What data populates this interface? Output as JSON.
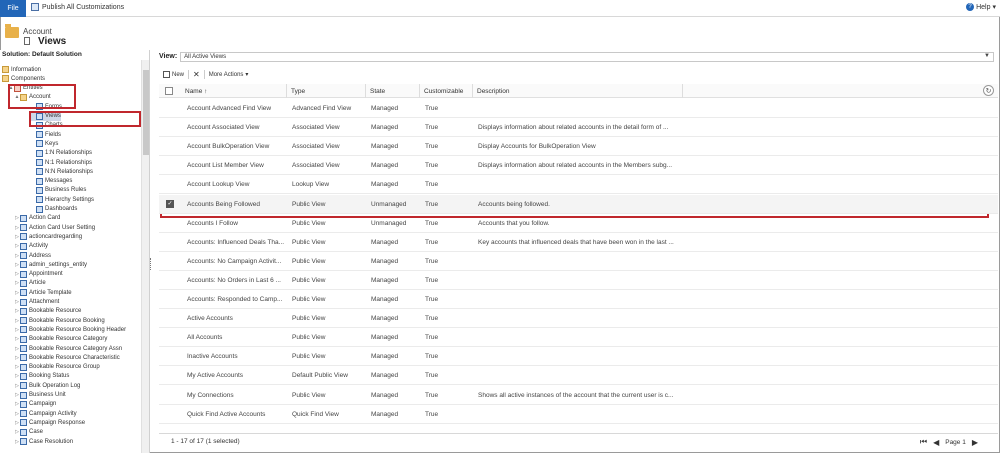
{
  "ribbon": {
    "file_label": "File",
    "publish_label": "Publish All Customizations",
    "help_label": "Help"
  },
  "header": {
    "entity_label": "Account",
    "page_title": "Views"
  },
  "nav": {
    "heading": "Solution: Default Solution",
    "items": [
      {
        "label": "Information",
        "level": 0,
        "twisty": "",
        "icon": "info-icon"
      },
      {
        "label": "Components",
        "level": 0,
        "twisty": "",
        "icon": "components-icon"
      },
      {
        "label": "Entities",
        "level": 1,
        "twisty": "▲",
        "icon": "entities-icon"
      },
      {
        "label": "Account",
        "level": 2,
        "twisty": "▲",
        "icon": "account-icon"
      },
      {
        "label": "Forms",
        "level": 3,
        "twisty": "",
        "icon": "forms-icon"
      },
      {
        "label": "Views",
        "level": 3,
        "twisty": "",
        "icon": "views-icon"
      },
      {
        "label": "Charts",
        "level": 3,
        "twisty": "",
        "icon": "charts-icon"
      },
      {
        "label": "Fields",
        "level": 3,
        "twisty": "",
        "icon": "fields-icon"
      },
      {
        "label": "Keys",
        "level": 3,
        "twisty": "",
        "icon": "keys-icon"
      },
      {
        "label": "1:N Relationships",
        "level": 3,
        "twisty": "",
        "icon": "relationship-icon"
      },
      {
        "label": "N:1 Relationships",
        "level": 3,
        "twisty": "",
        "icon": "relationship-icon"
      },
      {
        "label": "N:N Relationships",
        "level": 3,
        "twisty": "",
        "icon": "relationship-icon"
      },
      {
        "label": "Messages",
        "level": 3,
        "twisty": "",
        "icon": "messages-icon"
      },
      {
        "label": "Business Rules",
        "level": 3,
        "twisty": "",
        "icon": "rules-icon"
      },
      {
        "label": "Hierarchy Settings",
        "level": 3,
        "twisty": "",
        "icon": "hierarchy-icon"
      },
      {
        "label": "Dashboards",
        "level": 3,
        "twisty": "",
        "icon": "dashboards-icon"
      },
      {
        "label": "Action Card",
        "level": 2,
        "twisty": "▷",
        "icon": "entity-icon"
      },
      {
        "label": "Action Card User Setting",
        "level": 2,
        "twisty": "▷",
        "icon": "entity-icon"
      },
      {
        "label": "actioncardregarding",
        "level": 2,
        "twisty": "▷",
        "icon": "entity-icon"
      },
      {
        "label": "Activity",
        "level": 2,
        "twisty": "▷",
        "icon": "entity-icon"
      },
      {
        "label": "Address",
        "level": 2,
        "twisty": "▷",
        "icon": "entity-icon"
      },
      {
        "label": "admin_settings_entity",
        "level": 2,
        "twisty": "▷",
        "icon": "entity-icon"
      },
      {
        "label": "Appointment",
        "level": 2,
        "twisty": "▷",
        "icon": "entity-icon"
      },
      {
        "label": "Article",
        "level": 2,
        "twisty": "▷",
        "icon": "entity-icon"
      },
      {
        "label": "Article Template",
        "level": 2,
        "twisty": "▷",
        "icon": "entity-icon"
      },
      {
        "label": "Attachment",
        "level": 2,
        "twisty": "▷",
        "icon": "entity-icon"
      },
      {
        "label": "Bookable Resource",
        "level": 2,
        "twisty": "▷",
        "icon": "entity-icon"
      },
      {
        "label": "Bookable Resource Booking",
        "level": 2,
        "twisty": "▷",
        "icon": "entity-icon"
      },
      {
        "label": "Bookable Resource Booking Header",
        "level": 2,
        "twisty": "▷",
        "icon": "entity-icon"
      },
      {
        "label": "Bookable Resource Category",
        "level": 2,
        "twisty": "▷",
        "icon": "entity-icon"
      },
      {
        "label": "Bookable Resource Category Assn",
        "level": 2,
        "twisty": "▷",
        "icon": "entity-icon"
      },
      {
        "label": "Bookable Resource Characteristic",
        "level": 2,
        "twisty": "▷",
        "icon": "entity-icon"
      },
      {
        "label": "Bookable Resource Group",
        "level": 2,
        "twisty": "▷",
        "icon": "entity-icon"
      },
      {
        "label": "Booking Status",
        "level": 2,
        "twisty": "▷",
        "icon": "entity-icon"
      },
      {
        "label": "Bulk Operation Log",
        "level": 2,
        "twisty": "▷",
        "icon": "entity-icon"
      },
      {
        "label": "Business Unit",
        "level": 2,
        "twisty": "▷",
        "icon": "entity-icon"
      },
      {
        "label": "Campaign",
        "level": 2,
        "twisty": "▷",
        "icon": "entity-icon"
      },
      {
        "label": "Campaign Activity",
        "level": 2,
        "twisty": "▷",
        "icon": "entity-icon"
      },
      {
        "label": "Campaign Response",
        "level": 2,
        "twisty": "▷",
        "icon": "entity-icon"
      },
      {
        "label": "Case",
        "level": 2,
        "twisty": "▷",
        "icon": "entity-icon"
      },
      {
        "label": "Case Resolution",
        "level": 2,
        "twisty": "▷",
        "icon": "entity-icon"
      }
    ]
  },
  "view": {
    "label": "View:",
    "selected": "All Active Views"
  },
  "toolbar": {
    "new_label": "New",
    "more_actions_label": "More Actions"
  },
  "grid": {
    "columns": [
      "Name ↑",
      "Type",
      "State",
      "Customizable",
      "Description"
    ],
    "rows": [
      {
        "name": "Account Advanced Find View",
        "type": "Advanced Find View",
        "state": "Managed",
        "customizable": "True",
        "description": "",
        "selected": false
      },
      {
        "name": "Account Associated View",
        "type": "Associated View",
        "state": "Managed",
        "customizable": "True",
        "description": "Displays information about related accounts in the detail form of ...",
        "selected": false
      },
      {
        "name": "Account BulkOperation View",
        "type": "Associated View",
        "state": "Managed",
        "customizable": "True",
        "description": "Display Accounts for BulkOperation View",
        "selected": false
      },
      {
        "name": "Account List Member View",
        "type": "Associated View",
        "state": "Managed",
        "customizable": "True",
        "description": "Displays information about related accounts in the Members subg...",
        "selected": false
      },
      {
        "name": "Account Lookup View",
        "type": "Lookup View",
        "state": "Managed",
        "customizable": "True",
        "description": "",
        "selected": false
      },
      {
        "name": "Accounts Being Followed",
        "type": "Public View",
        "state": "Unmanaged",
        "customizable": "True",
        "description": "Accounts being followed.",
        "selected": true
      },
      {
        "name": "Accounts I Follow",
        "type": "Public View",
        "state": "Unmanaged",
        "customizable": "True",
        "description": "Accounts that you follow.",
        "selected": false
      },
      {
        "name": "Accounts: Influenced Deals Tha...",
        "type": "Public View",
        "state": "Managed",
        "customizable": "True",
        "description": "Key accounts that influenced deals that have been won in the last ...",
        "selected": false
      },
      {
        "name": "Accounts: No Campaign Activit...",
        "type": "Public View",
        "state": "Managed",
        "customizable": "True",
        "description": "",
        "selected": false
      },
      {
        "name": "Accounts: No Orders in Last 6 ...",
        "type": "Public View",
        "state": "Managed",
        "customizable": "True",
        "description": "",
        "selected": false
      },
      {
        "name": "Accounts: Responded to Camp...",
        "type": "Public View",
        "state": "Managed",
        "customizable": "True",
        "description": "",
        "selected": false
      },
      {
        "name": "Active Accounts",
        "type": "Public View",
        "state": "Managed",
        "customizable": "True",
        "description": "",
        "selected": false
      },
      {
        "name": "All Accounts",
        "type": "Public View",
        "state": "Managed",
        "customizable": "True",
        "description": "",
        "selected": false
      },
      {
        "name": "Inactive Accounts",
        "type": "Public View",
        "state": "Managed",
        "customizable": "True",
        "description": "",
        "selected": false
      },
      {
        "name": "My Active Accounts",
        "type": "Default Public View",
        "state": "Managed",
        "customizable": "True",
        "description": "",
        "selected": false
      },
      {
        "name": "My Connections",
        "type": "Public View",
        "state": "Managed",
        "customizable": "True",
        "description": "Shows all active instances of the account that the current user is c...",
        "selected": false
      },
      {
        "name": "Quick Find Active Accounts",
        "type": "Quick Find View",
        "state": "Managed",
        "customizable": "True",
        "description": "",
        "selected": false
      }
    ]
  },
  "footer": {
    "count_text": "1 - 17 of 17 (1 selected)",
    "page_label": "Page 1"
  },
  "colors": {
    "accent": "#2266b8",
    "highlight_box": "#c0272d"
  }
}
